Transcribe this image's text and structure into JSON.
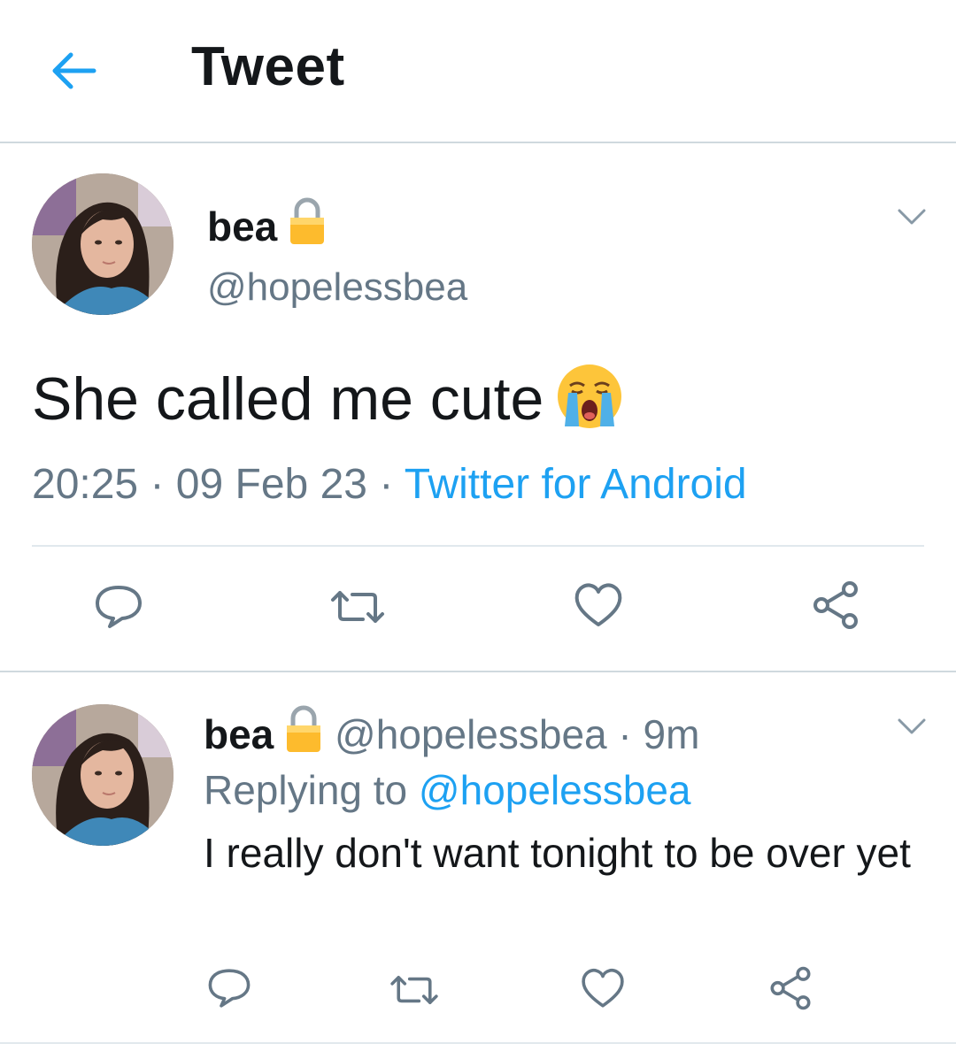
{
  "header": {
    "title": "Tweet",
    "back_icon": "arrow-left-icon"
  },
  "colors": {
    "accent": "#1da1f2",
    "text": "#14171a",
    "muted": "#657786",
    "divider": "#e1e8ed"
  },
  "main_tweet": {
    "display_name": "bea",
    "handle": "@hopelessbea",
    "text": "She called me cute",
    "emoji": "loudly-crying-face",
    "time": "20:25",
    "separator": "·",
    "date": "09 Feb 23",
    "source": "Twitter for Android"
  },
  "reply_tweet": {
    "display_name": "bea",
    "handle": "@hopelessbea",
    "separator": "·",
    "age": "9m",
    "replying_label": "Replying to",
    "replying_to": "@hopelessbea",
    "text": "I really don't want tonight to be over yet"
  },
  "actions": [
    "reply-icon",
    "retweet-icon",
    "like-icon",
    "share-icon"
  ]
}
